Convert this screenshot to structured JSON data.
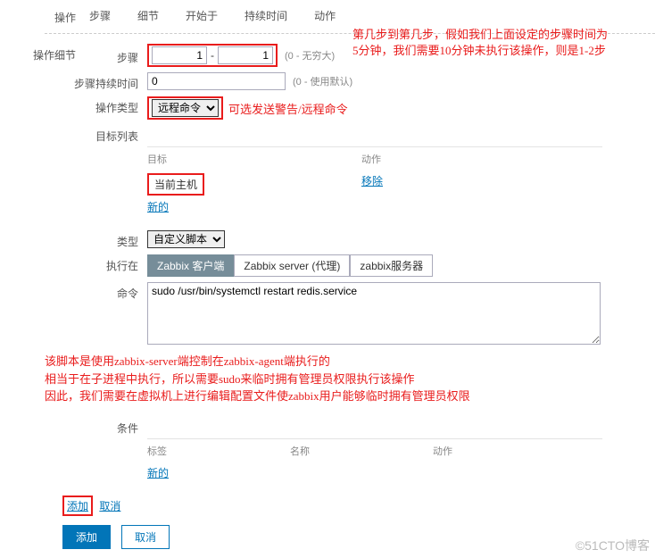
{
  "op_label": "操作",
  "tabs": {
    "steps": "步骤",
    "detail": "细节",
    "start": "开始于",
    "duration": "持续时间",
    "action": "动作"
  },
  "detail_label": "操作细节",
  "step": {
    "label": "步骤",
    "from": "1",
    "to": "1",
    "hint": "(0 - 无穷大)"
  },
  "step_duration": {
    "label": "步骤持续时间",
    "value": "0",
    "hint": "(0 - 使用默认)"
  },
  "op_type": {
    "label": "操作类型",
    "value": "远程命令"
  },
  "annotation_top1": "第几步到第几步，假如我们上面设定的步骤时间为",
  "annotation_top2": "5分钟，我们需要10分钟未执行该操作，则是1-2步",
  "annotation_type": "可选发送警告/远程命令",
  "targets": {
    "label": "目标列表",
    "head_target": "目标",
    "head_action": "动作",
    "current_host": "当前主机",
    "remove": "移除",
    "new": "新的"
  },
  "type": {
    "label": "类型",
    "value": "自定义脚本"
  },
  "exec": {
    "label": "执行在",
    "opt1": "Zabbix 客户端",
    "opt2": "Zabbix server (代理)",
    "opt3": "zabbix服务器"
  },
  "cmd": {
    "label": "命令",
    "value": "sudo /usr/bin/systemctl restart redis.service"
  },
  "script_note1": "该脚本是使用zabbix-server端控制在zabbix-agent端执行的",
  "script_note2": "相当于在子进程中执行，所以需要sudo来临时拥有管理员权限执行该操作",
  "script_note3": "因此，我们需要在虚拟机上进行编辑配置文件使zabbix用户能够临时拥有管理员权限",
  "cond": {
    "label": "条件",
    "head1": "标签",
    "head2": "名称",
    "head3": "动作",
    "new": "新的"
  },
  "inline_add": "添加",
  "inline_cancel": "取消",
  "bottom_add": "添加",
  "bottom_cancel": "取消",
  "watermark": "©51CTO博客"
}
